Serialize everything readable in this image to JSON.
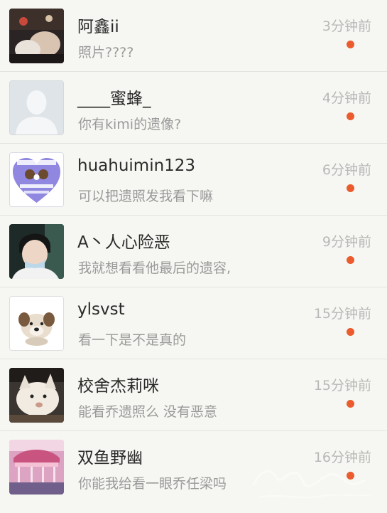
{
  "conversations": [
    {
      "name": "阿鑫ii",
      "message": "照片????",
      "time": "3分钟前",
      "avatar_icon": "concert-photo-avatar"
    },
    {
      "name": "____蜜蜂_",
      "message": "你有kimi的遗像?",
      "time": "4分钟前",
      "avatar_icon": "default-user-avatar"
    },
    {
      "name": "huahuimin123",
      "message": "可以把遗照发我看下嘛",
      "time": "6分钟前",
      "avatar_icon": "heart-sticker-avatar"
    },
    {
      "name": "A丶人心险恶",
      "message": "我就想看看他最后的遗容,",
      "time": "9分钟前",
      "avatar_icon": "portrait-photo-avatar"
    },
    {
      "name": "ylsvst",
      "message": "看一下是不是真的",
      "time": "15分钟前",
      "avatar_icon": "puppy-avatar"
    },
    {
      "name": "校舍杰莉咪",
      "message": "能看乔遗照么 没有恶意",
      "time": "15分钟前",
      "avatar_icon": "dog-photo-avatar"
    },
    {
      "name": "双鱼野幽",
      "message": "你能我给看一眼乔任梁吗",
      "time": "16分钟前",
      "avatar_icon": "carousel-photo-avatar"
    }
  ],
  "unread_dot_color": "#ea5c2e",
  "watermark_text": ""
}
